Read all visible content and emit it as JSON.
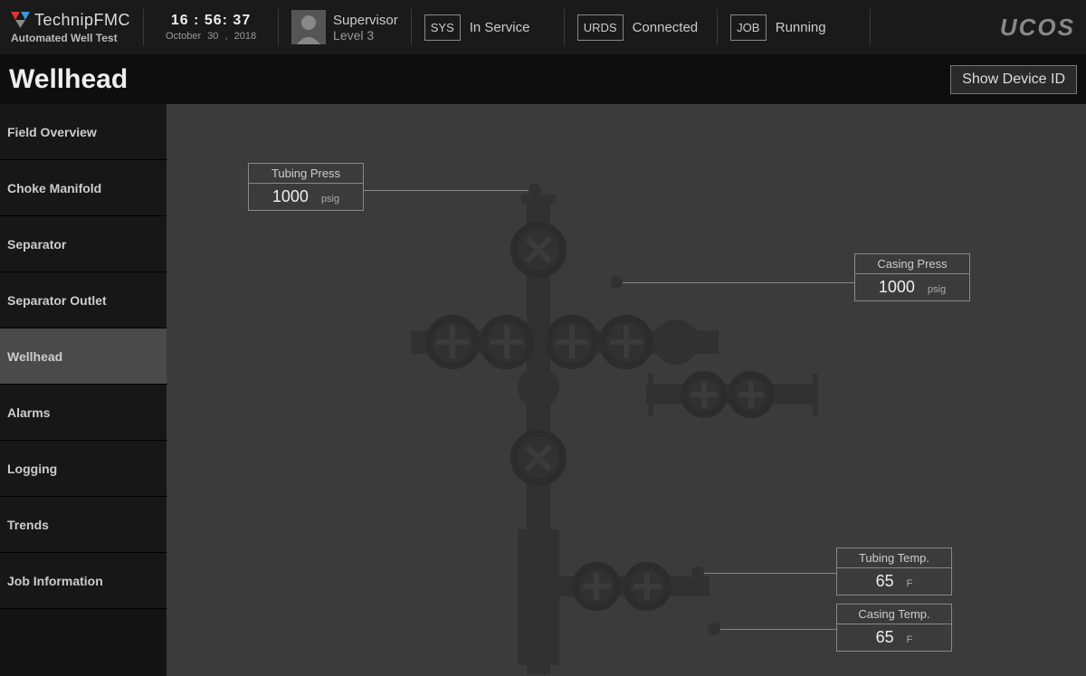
{
  "brand": {
    "name": "TechnipFMC",
    "subtitle": "Automated Well Test"
  },
  "clock": {
    "time": "16 : 56: 37",
    "date": "October   30 , 2018"
  },
  "user": {
    "role": "Supervisor",
    "level": "Level 3"
  },
  "status": {
    "sys": {
      "code": "SYS",
      "text": "In Service"
    },
    "urds": {
      "code": "URDS",
      "text": "Connected"
    },
    "job": {
      "code": "JOB",
      "text": "Running"
    }
  },
  "vendor": "UCOS",
  "page": {
    "title": "Wellhead",
    "show_id_btn": "Show Device ID"
  },
  "nav": [
    "Field Overview",
    "Choke Manifold",
    "Separator",
    "Separator Outlet",
    "Wellhead",
    "Alarms",
    "Logging",
    "Trends",
    "Job Information"
  ],
  "readouts": {
    "tubing_press": {
      "label": "Tubing Press",
      "value": "1000",
      "unit": "psig"
    },
    "casing_press": {
      "label": "Casing Press",
      "value": "1000",
      "unit": "psig"
    },
    "tubing_temp": {
      "label": "Tubing Temp.",
      "value": "65",
      "unit": "F"
    },
    "casing_temp": {
      "label": "Casing Temp.",
      "value": "65",
      "unit": "F"
    }
  }
}
